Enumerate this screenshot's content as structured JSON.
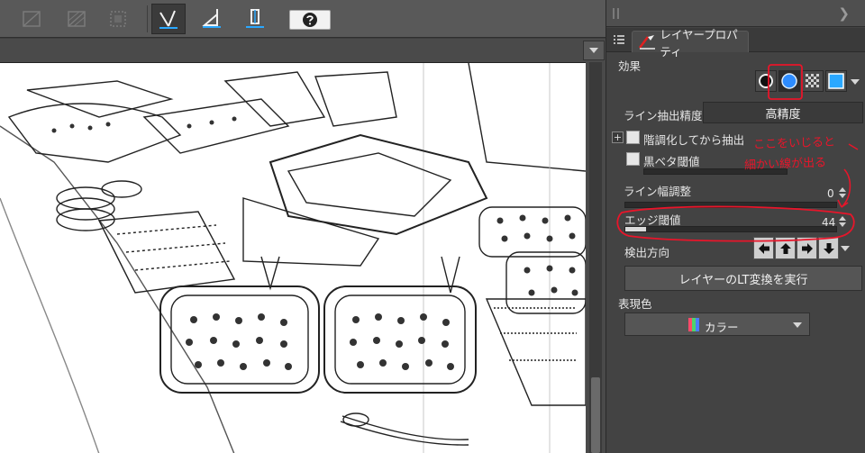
{
  "toolbar": {
    "buttons": [
      {
        "icon": "ruler-cross-icon",
        "state": "disabled"
      },
      {
        "icon": "ruler-hatch-icon",
        "state": "disabled"
      },
      {
        "icon": "selection-frame-icon",
        "state": "disabled"
      },
      {
        "icon": "ruler-pen-icon",
        "state": "active"
      },
      {
        "icon": "ruler-angle-icon",
        "state": "normal"
      },
      {
        "icon": "ruler-perspective-icon",
        "state": "normal"
      },
      {
        "icon": "help-icon",
        "state": "normal"
      }
    ]
  },
  "panel": {
    "tab_label": "レイヤープロパティ",
    "section_effect": "効果",
    "line_precision_label": "ライン抽出精度",
    "line_precision_value": "高精度",
    "posterize_label": "階調化してから抽出",
    "black_fill_label": "黒ベタ閾値",
    "line_width_label": "ライン幅調整",
    "line_width_value": "0",
    "edge_threshold_label": "エッジ閾値",
    "edge_threshold_value": "44",
    "edge_threshold_level": 0.1,
    "direction_label": "検出方向",
    "direction_buttons": [
      "left",
      "up",
      "right",
      "down"
    ],
    "run_button_label": "レイヤーのLT変換を実行",
    "section_color": "表現色",
    "color_value": "カラー"
  },
  "annotation": {
    "line1": "ここをいじると",
    "line2": "細かい線が出る",
    "color": "#e8152a"
  }
}
